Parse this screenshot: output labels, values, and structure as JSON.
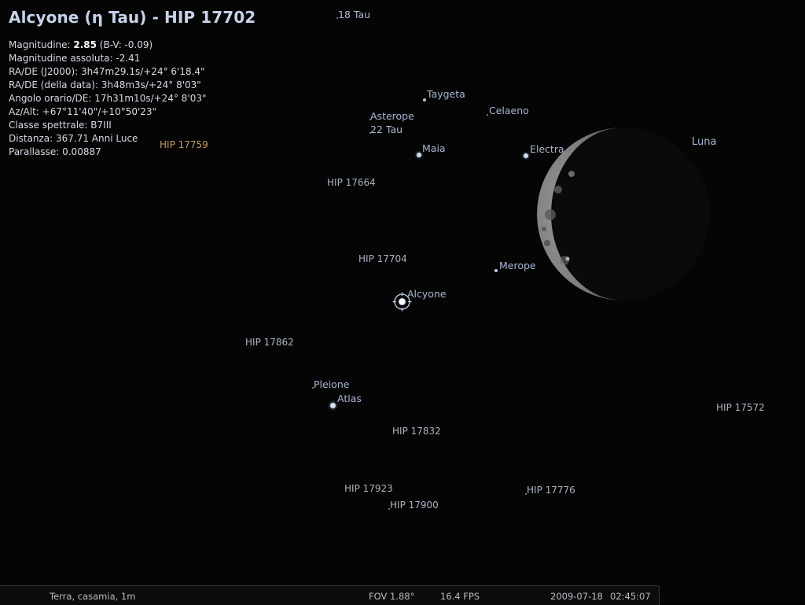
{
  "selected_object": {
    "title": "Alcyone (η Tau) - HIP 17702",
    "magnitude_label": "Magnitudine: ",
    "magnitude_value": "2.85",
    "magnitude_bv": " (B-V: -0.09)",
    "abs_magnitude": "Magnitudine assoluta: -2.41",
    "radec_j2000": "RA/DE (J2000): 3h47m29.1s/+24° 6'18.4\"",
    "radec_date": "RA/DE (della data): 3h48m3s/+24° 8'03\"",
    "hour_angle": "Angolo orario/DE: 17h31m10s/+24° 8'03\"",
    "az_alt": "Az/Alt: +67°11'40\"/+10°50'23\"",
    "spectral_class": "Classe spettrale: B7III",
    "distance": "Distanza: 367.71 Anni Luce",
    "parallax": "Parallasse: 0.00887"
  },
  "labels": {
    "tau18": "18 Tau",
    "taygeta": "Taygeta",
    "celaeno": "Celaeno",
    "asterope": "Asterope",
    "tau22": "22 Tau",
    "maia": "Maia",
    "electra": "Electra",
    "luna": "Luna",
    "hip17759": "HIP 17759",
    "hip17664": "HIP 17664",
    "hip17704": "HIP 17704",
    "merope": "Merope",
    "alcyone": "Alcyone",
    "hip17862": "HIP 17862",
    "pleione": "Pleione",
    "atlas": "Atlas",
    "hip17572": "HIP 17572",
    "hip17832": "HIP 17832",
    "hip17923": "HIP 17923",
    "hip17776": "HIP 17776",
    "hip17900": "HIP 17900"
  },
  "statusbar": {
    "location": "Terra, casamia, 1m",
    "fov": "FOV 1.88°",
    "fps": "16.4 FPS",
    "date": "2009-07-18",
    "time": "02:45:07"
  },
  "colors": {
    "title": "#c7d3ea",
    "star_label": "#a8b6d1",
    "hip_label": "#aab3c0",
    "hip_highlight": "#c49a6c",
    "background": "#050506"
  },
  "icons": {
    "selection_marker": "crosshair-circle-icon"
  }
}
